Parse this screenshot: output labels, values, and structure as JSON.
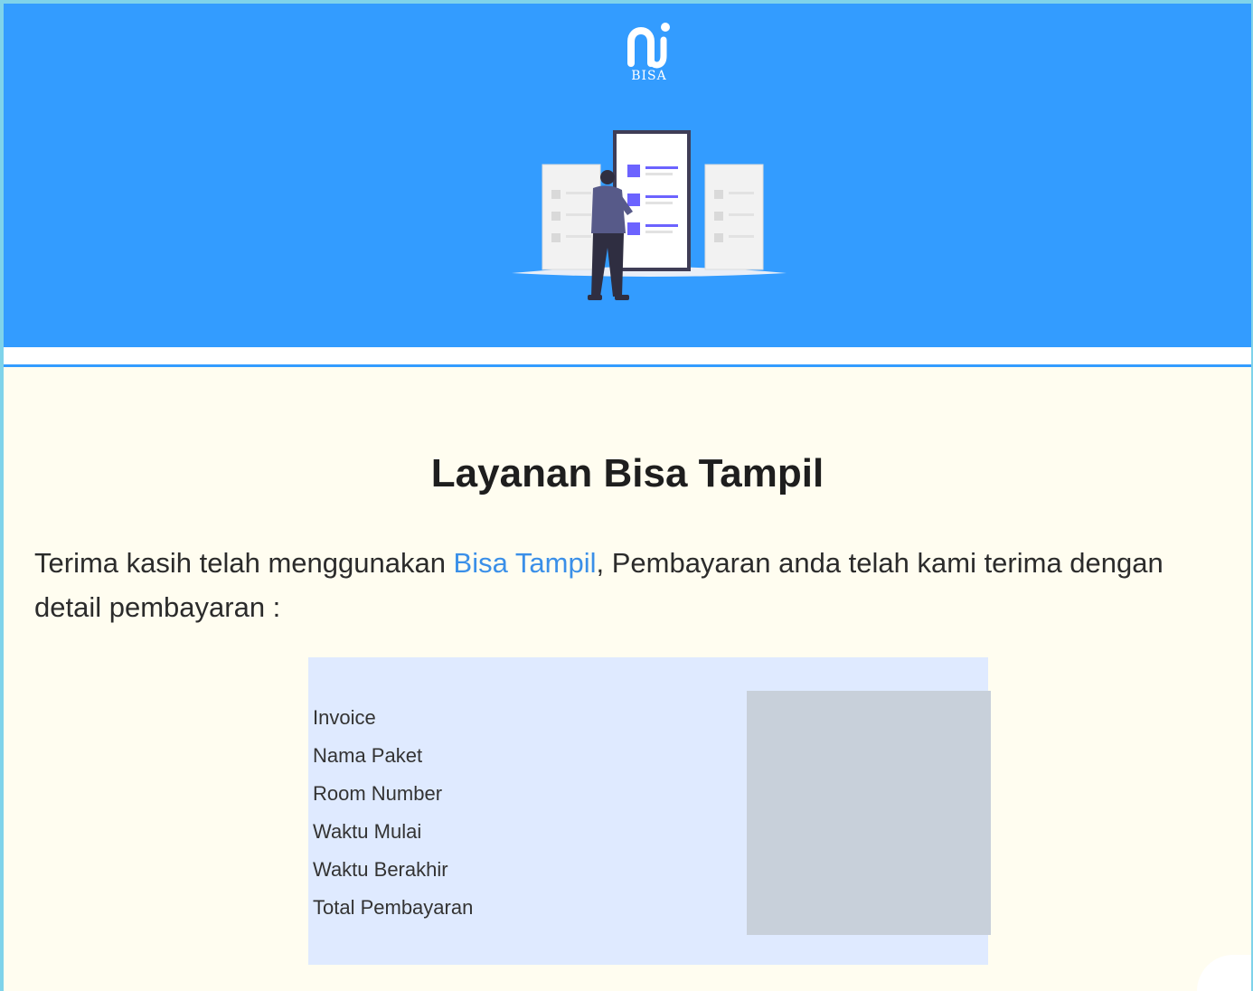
{
  "brand": {
    "logo_text": "BISA"
  },
  "heading": "Layanan Bisa Tampil",
  "intro": {
    "before": "Terima kasih telah menggunakan ",
    "link": "Bisa Tampil",
    "after": ", Pembayaran anda telah kami terima dengan detail pembayaran :"
  },
  "details": {
    "labels": [
      "Invoice",
      "Nama Paket",
      "Room Number",
      "Waktu Mulai",
      "Waktu Berakhir",
      "Total Pembayaran"
    ]
  },
  "colors": {
    "hero": "#339cff",
    "page": "#fffdf0",
    "details": "#dfeaff",
    "link": "#3a8fe8",
    "accent": "#6c63ff"
  }
}
